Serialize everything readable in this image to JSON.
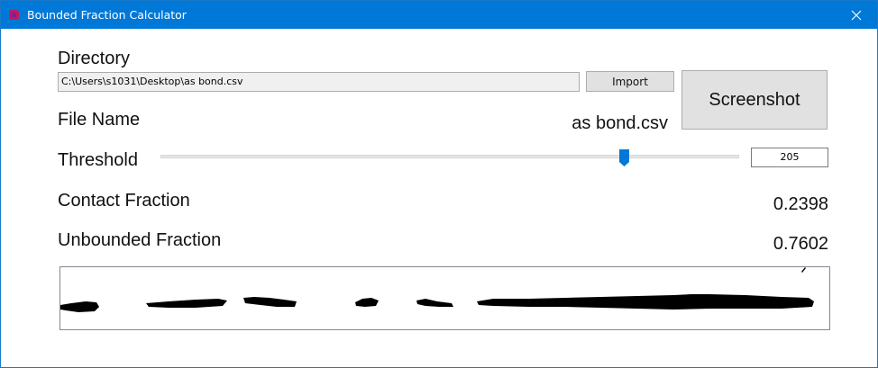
{
  "window": {
    "title": "Bounded Fraction Calculator",
    "icon": "app-icon",
    "close_icon": "close-icon",
    "titlebar_color": "#0078d7"
  },
  "directory": {
    "label": "Directory",
    "path": "C:\\Users\\s1031\\Desktop\\as bond.csv",
    "import_label": "Import"
  },
  "screenshot": {
    "label": "Screenshot"
  },
  "file": {
    "label": "File Name",
    "value": "as bond.csv"
  },
  "threshold": {
    "label": "Threshold",
    "value": "205",
    "slider_fraction": 0.8,
    "accent_color": "#0078d7"
  },
  "contact": {
    "label": "Contact Fraction",
    "value": "0.2398"
  },
  "unbounded": {
    "label": "Unbounded Fraction",
    "value": "0.7602"
  }
}
